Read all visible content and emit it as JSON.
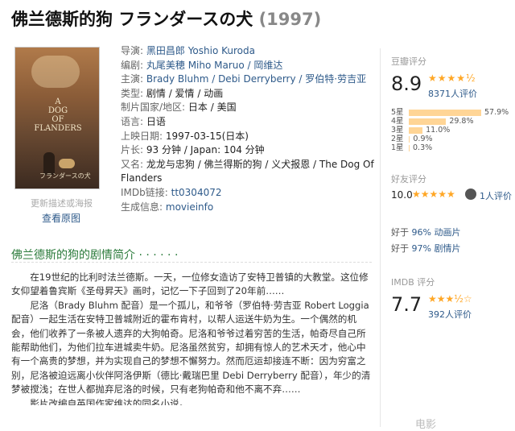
{
  "title": {
    "name": "佛兰德斯的狗 フランダースの犬",
    "year": "(1997)"
  },
  "poster": {
    "title_lines": [
      "A",
      "DOG",
      "OF",
      "FLANDERS"
    ],
    "bottom_text": "フランダースの犬",
    "caption": "更新描述或海报",
    "view_label": "查看原图"
  },
  "info": [
    {
      "label": "导演:",
      "value": "黑田昌郎 Yoshio Kuroda",
      "link": true
    },
    {
      "label": "编剧:",
      "value": "丸尾美穂 Miho Maruo / 岡维达",
      "link": true
    },
    {
      "label": "主演:",
      "value": "Brady Bluhm / Debi Derryberry / 罗伯特·劳吉亚",
      "link": true
    },
    {
      "label": "类型:",
      "value": "剧情 / 爱情 / 动画",
      "link": false
    },
    {
      "label": "制片国家/地区:",
      "value": "日本 / 美国",
      "link": false
    },
    {
      "label": "语言:",
      "value": "日语",
      "link": false
    },
    {
      "label": "上映日期:",
      "value": "1997-03-15(日本)",
      "link": false
    },
    {
      "label": "片长:",
      "value": "93 分钟 / Japan: 104 分钟",
      "link": false
    },
    {
      "label": "又名:",
      "value": "龙龙与忠狗 / 佛兰得斯的狗 / 义犬报恩 / The Dog Of",
      "link": false
    },
    {
      "label": "",
      "value": "Flanders",
      "link": false
    },
    {
      "label": "IMDb链接:",
      "value": "tt0304072",
      "link": true
    },
    {
      "label": "生成信息:",
      "value": "movieinfo",
      "link": true
    }
  ],
  "douban": {
    "label": "豆瓣评分",
    "score": "8.9",
    "stars": "★★★★½",
    "votes": "8371人评价",
    "distribution": [
      {
        "label": "5星",
        "percent": 57.9,
        "text": "57.9%"
      },
      {
        "label": "4星",
        "percent": 29.8,
        "text": "29.8%"
      },
      {
        "label": "3星",
        "percent": 11.0,
        "text": "11.0%"
      },
      {
        "label": "2星",
        "percent": 0.9,
        "text": "0.9%"
      },
      {
        "label": "1星",
        "percent": 0.3,
        "text": "0.3%"
      }
    ]
  },
  "friends": {
    "label": "好友评分",
    "score": "10.0",
    "stars": "★★★★★",
    "count": "1人评价"
  },
  "better": {
    "line1_prefix": "好于",
    "line1_link": "96% 动画片",
    "line2_prefix": "好于",
    "line2_link": "97% 剧情片"
  },
  "imdb": {
    "label": "IMDB 评分",
    "score": "7.7",
    "stars": "★★★½☆",
    "votes": "392人评价"
  },
  "plot": {
    "heading": "佛兰德斯的狗的剧情简介 · · · · · ·",
    "p1": "在19世纪的比利时法兰德斯。一天，一位修女造访了安特卫普镇的大教堂。这位修女仰望着鲁宾斯《圣母昇天》画时，记忆一下子回到了20年前……",
    "p2": "尼洛（Brady Bluhm 配音）是一个孤儿，和爷爷（罗伯特·劳吉亚 Robert Loggia 配音）一起生活在安特卫普城附近的霍布肯村，以帮人运送牛奶为生。一个偶然的机会，他们收养了一条被人遗弃的大狗帕奇。尼洛和爷爷过着穷苦的生活，帕奇尽自己所能帮助他们，为他们拉车进城卖牛奶。尼洛虽然贫穷，却拥有惊人的艺术天才，他心中有一个高贵的梦想，并为实现自己的梦想不懈努力。然而厄运却接连不断：因为穷富之别，尼洛被迫远离小伙伴阿洛伊斯（德比·戴瑞巴里 Debi Derryberry 配音），年少的清梦被搅浅；在世人都抛弃尼洛的时候，只有老狗帕奇和他不离不弃……",
    "p3": "影片改编自英国作家维达的同名小说。"
  },
  "watermark": "电影"
}
